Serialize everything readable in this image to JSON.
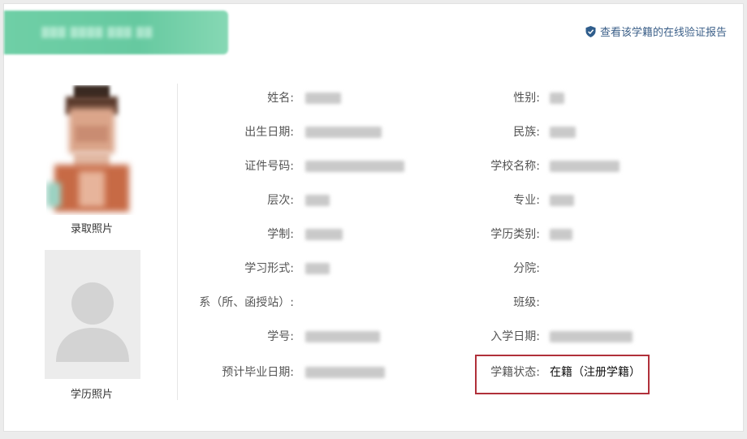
{
  "verify_link": {
    "text": "查看该学籍的在线验证报告",
    "icon": "shield-check-icon",
    "color": "#3b5f88"
  },
  "photos": {
    "admission_label": "录取照片",
    "education_label": "学历照片"
  },
  "left_fields": [
    {
      "key": "name",
      "label": "姓名:"
    },
    {
      "key": "birth_date",
      "label": "出生日期:"
    },
    {
      "key": "id_number",
      "label": "证件号码:"
    },
    {
      "key": "level",
      "label": "层次:"
    },
    {
      "key": "length_of_schooling",
      "label": "学制:"
    },
    {
      "key": "study_form",
      "label": "学习形式:"
    },
    {
      "key": "department",
      "label": "系（所、函授站）:"
    },
    {
      "key": "student_number",
      "label": "学号:"
    },
    {
      "key": "expected_graduation",
      "label": "预计毕业日期:"
    }
  ],
  "right_fields": [
    {
      "key": "gender",
      "label": "性别:"
    },
    {
      "key": "ethnicity",
      "label": "民族:"
    },
    {
      "key": "school_name",
      "label": "学校名称:"
    },
    {
      "key": "major",
      "label": "专业:"
    },
    {
      "key": "education_type",
      "label": "学历类别:"
    },
    {
      "key": "branch",
      "label": "分院:"
    },
    {
      "key": "class",
      "label": "班级:"
    },
    {
      "key": "enrollment_date",
      "label": "入学日期:"
    },
    {
      "key": "enrollment_status",
      "label": "学籍状态:",
      "value": "在籍（注册学籍）",
      "highlight_color": "#b0303a"
    }
  ],
  "colors": {
    "banner": "#6fcfa6",
    "status_border": "#b0303a"
  }
}
